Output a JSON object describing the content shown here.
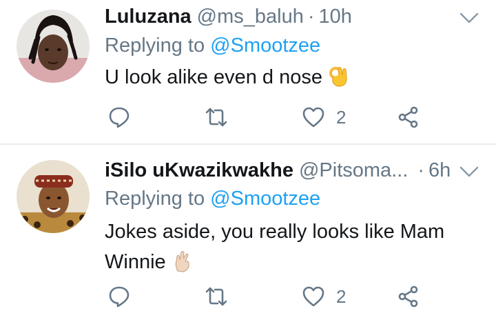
{
  "tweets": [
    {
      "display_name": "Luluzana",
      "handle": "@ms_baluh",
      "separator": "·",
      "time": "10h",
      "replying_prefix": "Replying to ",
      "replying_to": "@Smootzee",
      "text": "U look alike even d nose",
      "emoji": "ok-hand-emoji",
      "likes": "2"
    },
    {
      "display_name": "iSilo uKwazikwakhe",
      "handle": "@Pitsoma...",
      "separator": "·",
      "time": "6h",
      "replying_prefix": "Replying to ",
      "replying_to": "@Smootzee",
      "text": "Jokes aside, you really looks like Mam Winnie",
      "emoji": "crossed-fingers-emoji",
      "likes": "2"
    }
  ],
  "icons": {
    "reply": "reply-icon",
    "retweet": "retweet-icon",
    "like": "heart-icon",
    "share": "share-icon",
    "menu": "chevron-down-icon"
  },
  "colors": {
    "text": "#14171a",
    "secondary": "#657786",
    "mention": "#1da1f2",
    "divider": "#e6ecf0"
  }
}
